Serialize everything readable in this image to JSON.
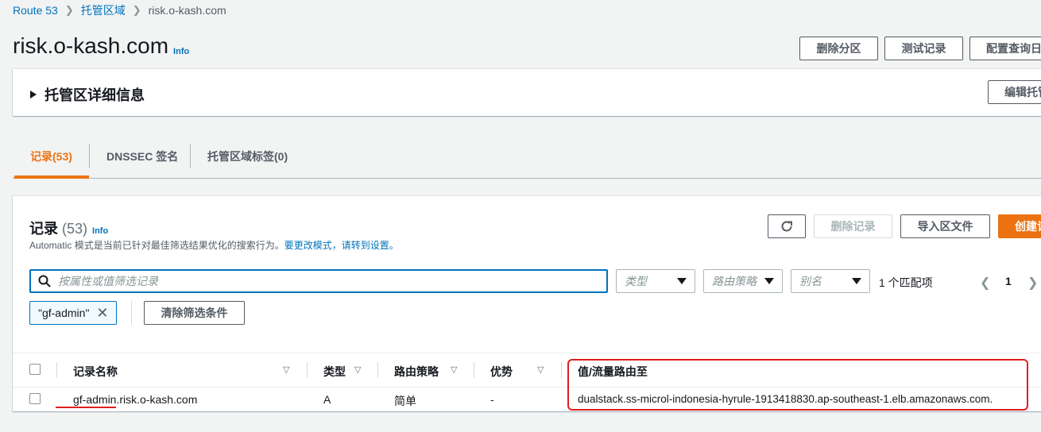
{
  "breadcrumb": {
    "root": "Route 53",
    "section": "托管区域",
    "current": "risk.o-kash.com"
  },
  "header": {
    "title": "risk.o-kash.com",
    "info": "Info",
    "buttons": {
      "delete_zone": "删除分区",
      "test_record": "测试记录",
      "query_log": "配置查询日"
    }
  },
  "details": {
    "title": "托管区详细信息",
    "edit_button": "编辑托管"
  },
  "tabs": [
    {
      "label": "记录(53)",
      "active": true
    },
    {
      "label": "DNSSEC 签名",
      "active": false
    },
    {
      "label": "托管区域标签(0)",
      "active": false
    }
  ],
  "records": {
    "title": "记录",
    "count": "(53)",
    "info": "Info",
    "desc_prefix": "Automatic 模式是当前已针对最佳筛选结果优化的搜索行为。",
    "desc_link": "要更改模式，请转到设置。",
    "refresh_icon": "refresh-icon",
    "delete_button": "删除记录",
    "import_button": "导入区文件",
    "create_button": "创建记"
  },
  "filters": {
    "search_placeholder": "按属性或值筛选记录",
    "type_placeholder": "类型",
    "routing_placeholder": "路由策略",
    "alias_placeholder": "别名",
    "matches": "1 个匹配项",
    "page": "1",
    "token": "\"gf-admin\"",
    "clear_button": "清除筛选条件"
  },
  "table": {
    "headers": {
      "name": "记录名称",
      "type": "类型",
      "routing": "路由策略",
      "differentiator": "优势",
      "value": "值/流量路由至"
    },
    "rows": [
      {
        "name": "gf-admin.risk.o-kash.com",
        "type": "A",
        "routing": "简单",
        "differentiator": "-",
        "value": "dualstack.ss-microl-indonesia-hyrule-1913418830.ap-southeast-1.elb.amazonaws.com."
      }
    ]
  },
  "colors": {
    "accent": "#ec7211",
    "link": "#0073bb",
    "annotation": "#e01e1e"
  }
}
